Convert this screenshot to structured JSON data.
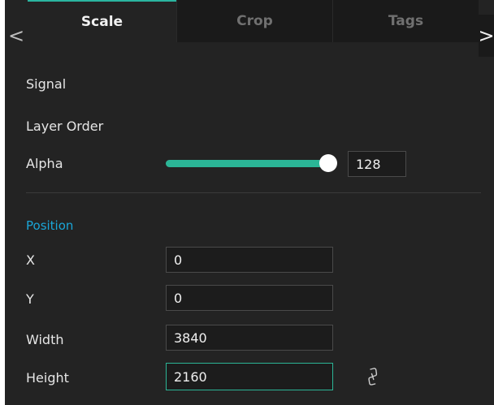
{
  "tabs": [
    {
      "label": "Scale",
      "active": true
    },
    {
      "label": "Crop",
      "active": false
    },
    {
      "label": "Tags",
      "active": false
    }
  ],
  "nav": {
    "prev_icon": "chevron-left-icon",
    "next_icon": "chevron-right-icon",
    "prev_glyph": "<",
    "next_glyph": ">"
  },
  "properties": {
    "signal_label": "Signal",
    "layer_order_label": "Layer Order",
    "alpha_label": "Alpha",
    "alpha_value": "128",
    "alpha_fraction": 1.0
  },
  "position": {
    "section_title": "Position",
    "x_label": "X",
    "x_value": "0",
    "y_label": "Y",
    "y_value": "0",
    "width_label": "Width",
    "width_value": "3840",
    "height_label": "Height",
    "height_value": "2160",
    "lock_icon": "link-icon"
  },
  "colors": {
    "accent": "#2bb596",
    "section_title": "#1aa6d8",
    "panel_bg": "#232323"
  }
}
